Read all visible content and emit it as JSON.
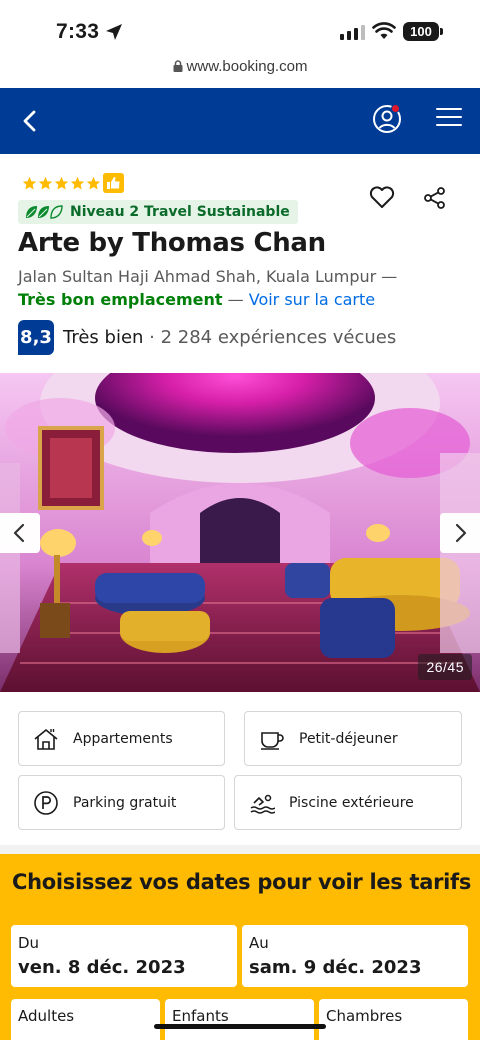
{
  "status_bar": {
    "time": "7:33",
    "battery": "100"
  },
  "browser": {
    "url": "www.booking.com"
  },
  "colors": {
    "brand_blue": "#003b95",
    "accent_yellow": "#febb02",
    "link_blue": "#006ce4",
    "green": "#008009"
  },
  "hotel": {
    "stars": 5,
    "sustainability_label": "Niveau 2 Travel Sustainable",
    "name": "Arte by Thomas Chan",
    "address": "Jalan Sultan Haji Ahmad Shah, Kuala Lumpur —",
    "location_rating": "Très bon emplacement",
    "location_sep": " — ",
    "map_link": "Voir sur la carte",
    "score": "8,3",
    "score_word": "Très bien",
    "score_count": " · 2 284 expériences vécues"
  },
  "gallery": {
    "counter": "26/45"
  },
  "amenities": [
    {
      "label": "Appartements",
      "icon": "house-icon"
    },
    {
      "label": "Petit-déjeuner",
      "icon": "coffee-cup-icon"
    },
    {
      "label": "Parking gratuit",
      "icon": "parking-icon"
    },
    {
      "label": "Piscine extérieure",
      "icon": "swimmer-icon"
    }
  ],
  "search": {
    "title": "Choisissez vos dates pour voir les tarifs",
    "checkin_label": "Du",
    "checkin_value": "ven. 8 déc. 2023",
    "checkout_label": "Au",
    "checkout_value": "sam. 9 déc. 2023",
    "adults_label": "Adultes",
    "children_label": "Enfants",
    "rooms_label": "Chambres"
  }
}
